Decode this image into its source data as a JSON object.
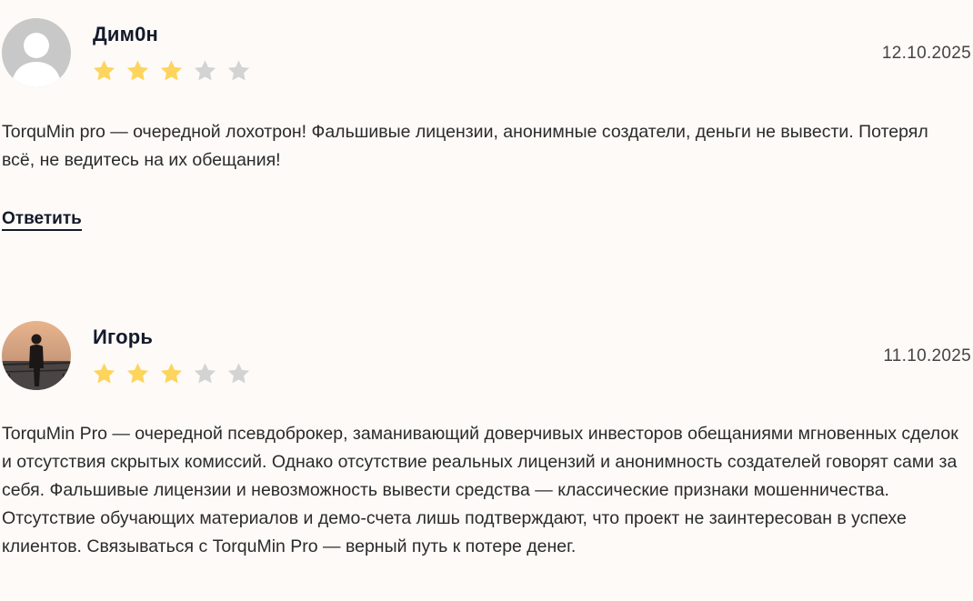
{
  "reviews": [
    {
      "author": "Дим0н",
      "date": "12.10.2025",
      "rating": 3,
      "max_rating": 5,
      "avatar": "default-user-avatar",
      "text": "TorquMin pro — очередной лохотрон! Фальшивые лицензии, анонимные создатели, деньги не вывести. Потерял всё, не ведитесь на их обещания!",
      "reply_label": "Ответить"
    },
    {
      "author": "Игорь",
      "date": "11.10.2025",
      "rating": 3,
      "max_rating": 5,
      "avatar": "user-photo-avatar",
      "text": "TorquMin Pro — очередной псевдоброкер, заманивающий доверчивых инвесторов обещаниями мгновенных сделок и отсутствия скрытых комиссий. Однако отсутствие реальных лицензий и анонимность создателей говорят сами за себя. Фальшивые лицензии и невозможность вывести средства — классические признаки мошенничества. Отсутствие обучающих материалов и демо-счета лишь подтверждают, что проект не заинтересован в успехе клиентов. Связываться с TorquMin Pro — верный путь к потере денег."
    }
  ],
  "colors": {
    "background": "#fdfaf7",
    "star_filled": "#fdd45c",
    "star_empty": "#d3d3d3",
    "author": "#141a2b",
    "text": "#2b2b2b"
  }
}
